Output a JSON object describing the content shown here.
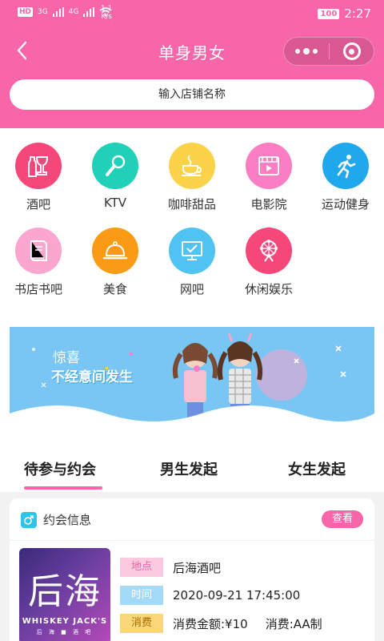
{
  "status_bar": {
    "left_tag": "HD",
    "signal_1": "3G",
    "signal_2": "4G",
    "speed_value": "1.1",
    "speed_unit": "K/s",
    "battery": "100",
    "time": "2:27"
  },
  "navbar": {
    "title": "单身男女"
  },
  "search": {
    "placeholder": "输入店铺名称"
  },
  "categories": [
    {
      "label": "酒吧",
      "color": "#f5477a",
      "icon": "wine-glass-icon"
    },
    {
      "label": "KTV",
      "color": "#21d0b8",
      "icon": "microphone-icon"
    },
    {
      "label": "咖啡甜品",
      "color": "#fbd24a",
      "icon": "coffee-cup-icon"
    },
    {
      "label": "电影院",
      "color": "#fb7ec4",
      "icon": "film-icon"
    },
    {
      "label": "运动健身",
      "color": "#1fa8ec",
      "icon": "running-man-icon"
    },
    {
      "label": "书店书吧",
      "color": "#fba6cf",
      "icon": "book-icon"
    },
    {
      "label": "美食",
      "color": "#fb9a14",
      "icon": "food-cloche-icon"
    },
    {
      "label": "网吧",
      "color": "#4fc3f2",
      "icon": "computer-monitor-icon"
    },
    {
      "label": "休闲娱乐",
      "color": "#f5477a",
      "icon": "ferris-wheel-icon"
    }
  ],
  "banner": {
    "line1": "惊喜",
    "line2": "不经意间发生"
  },
  "tabs": [
    {
      "label": "待参与约会",
      "active": true
    },
    {
      "label": "男生发起",
      "active": false
    },
    {
      "label": "女生发起",
      "active": false
    }
  ],
  "date_card": {
    "title": "约会信息",
    "view_label": "查看",
    "logo": {
      "main": "后海",
      "sub": "WHISKEY JACK'S",
      "sub2": "后 海 ■ 酒 吧"
    },
    "location_label": "地点",
    "location_value": "后海酒吧",
    "time_label": "时间",
    "time_value": "2020-09-21 17:45:00",
    "cost_label": "消费",
    "cost_amount": "消费金额:¥10",
    "cost_method": "消费:AA制"
  },
  "colors": {
    "brand_pink": "#f865a8",
    "banner_blue": "#79c6f5"
  }
}
